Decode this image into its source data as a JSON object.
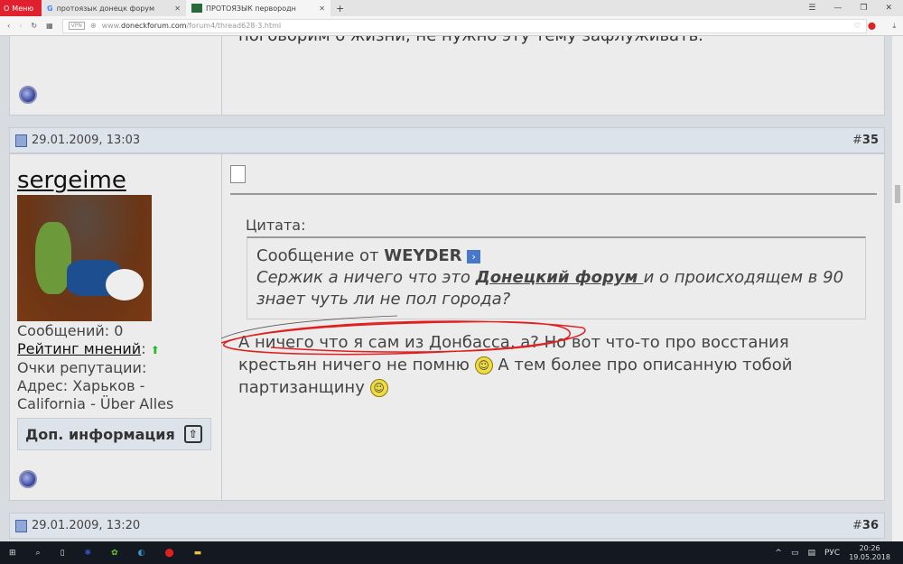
{
  "browser": {
    "menu_label": "Меню",
    "tabs": [
      {
        "title": "протоязык донецк форум"
      },
      {
        "title": "ПРОТОЯЗЫК первородн"
      }
    ],
    "url_host": "www.doneckforum.com",
    "url_prefix": "www.",
    "url_domain": "doneckforum.com",
    "url_path": "/forum4/thread628-3.html",
    "vpn": "VPN"
  },
  "prev_post": {
    "text": "поговорим о жизни, не нужно эту тему зафлуживать."
  },
  "post": {
    "date": "29.01.2009, 13:03",
    "number_prefix": "#",
    "number": "35",
    "username": "sergeime",
    "stats": {
      "messages": "Сообщений: 0",
      "rating_label": "Рейтинг мнений",
      "rating_colon": ":",
      "reputation": "Очки репутации:",
      "address_line1": "Адрес: Харьков -",
      "address_line2": "California - Über Alles"
    },
    "more_info": "Доп. информация",
    "quote": {
      "label": "Цитата:",
      "from_prefix": "Сообщение от",
      "author": "WEYDER",
      "text_before": "Сержик а ничего что это ",
      "link": "Донецкий форум ",
      "text_after": "и о происходящем в 90 знает чуть ли не пол города?"
    },
    "message": {
      "part1": "А ничего что я сам из Донбасса, а? Но вот что-то про восстания крестьян ничего не помню ",
      "part2": " А тем более про описанную тобой партизанщину "
    }
  },
  "next_post": {
    "date": "29.01.2009, 13:20",
    "number_prefix": "#",
    "number": "36"
  },
  "taskbar": {
    "lang": "РУС",
    "time": "20:26",
    "date": "19.05.2018"
  }
}
